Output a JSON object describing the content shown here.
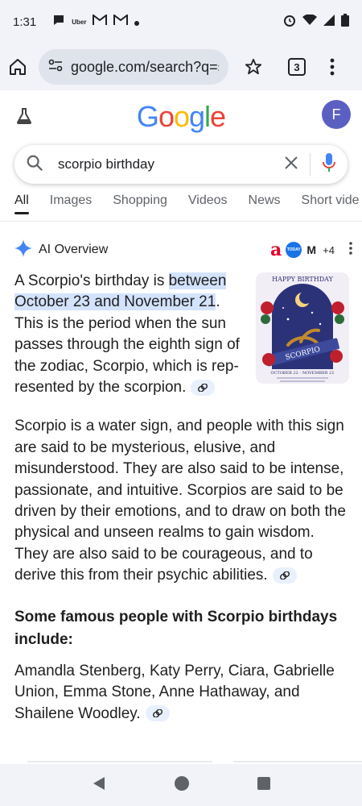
{
  "status_bar": {
    "time": "1:31",
    "uber_label": "Uber"
  },
  "browser": {
    "url": "google.com/search?q=sc",
    "tab_count": "3"
  },
  "header": {
    "logo_letters": [
      "G",
      "o",
      "o",
      "g",
      "l",
      "e"
    ],
    "avatar_letter": "F"
  },
  "search": {
    "query": "scorpio birthday"
  },
  "tabs": [
    {
      "label": "All",
      "active": true
    },
    {
      "label": "Images"
    },
    {
      "label": "Shopping"
    },
    {
      "label": "Videos"
    },
    {
      "label": "News"
    },
    {
      "label": "Short vide"
    }
  ],
  "ai_overview": {
    "title": "AI Overview",
    "source_more": "+4",
    "source_a": "a",
    "source_b": "TODAY",
    "source_c": "M",
    "para1_before": "A Scorpio's birthday is ",
    "para1_highlight": "between October 23 and November 21",
    "para1_after": ". This is the period when the sun passes through the eighth sign of the zodiac, Scorpio, which is rep-resented by the scorpion.",
    "para2": "Scorpio is a water sign, and people with this sign are said to be mysterious, elusive, and misunderstood. They are also said to be intense, passionate, and intuitive. Scorpios are said to be driven by their emotions, and to draw on both the physical and unseen realms to gain wisdom. They are also said to be courageous, and to derive this from their psychic abilities.",
    "heading": "Some famous people with Scorpio birthdays include:",
    "para3": "Amandla Stenberg, Katy Perry, Ciara, Gabrielle Union, Emma Stone, Anne Hathaway, and Shailene Woodley.",
    "image": {
      "top_text": "HAPPY BIRTHDAY",
      "banner": "SCORPIO",
      "dates": "OCTOBER 22 - NOVEMBER 21"
    }
  },
  "colors": {
    "accent": "#4285f4",
    "highlight": "#d3e3fd",
    "avatar": "#5c5fc2"
  }
}
